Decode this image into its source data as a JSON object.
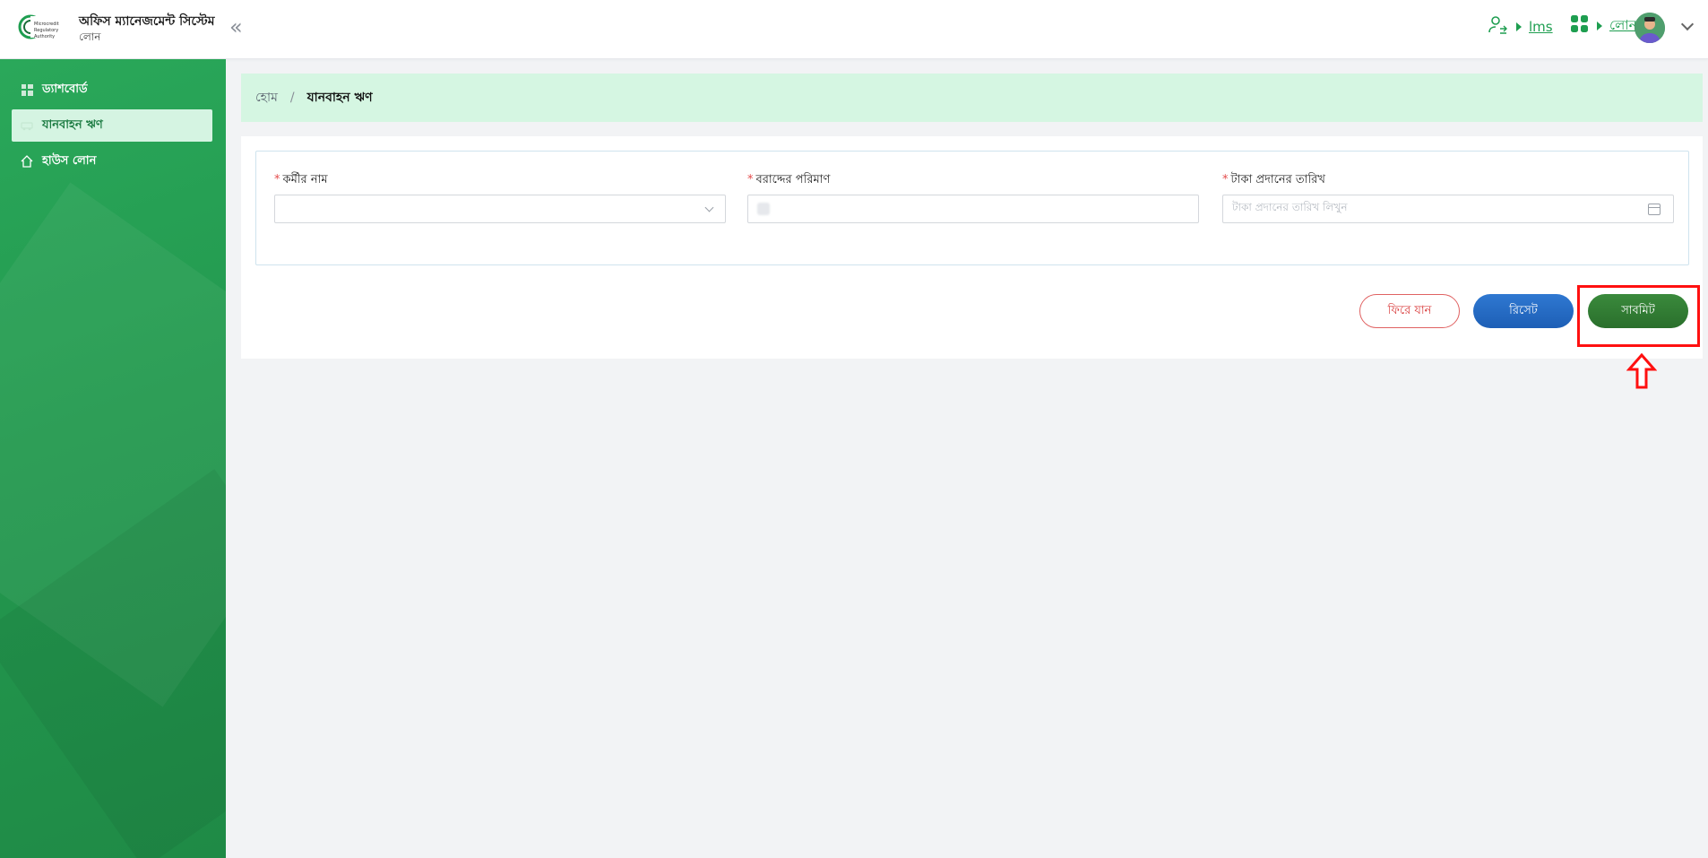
{
  "header": {
    "app_title": "অফিস ম্যানেজমেন্ট সিস্টেম",
    "app_subtitle": "লোন",
    "logo_text": [
      "Microcredit",
      "Regulatory",
      "Authority"
    ],
    "links": [
      {
        "label": "lms",
        "icon": "user-switch-icon"
      },
      {
        "label": "লোন",
        "icon": "apps-grid-icon"
      }
    ]
  },
  "sidebar": {
    "items": [
      {
        "label": "ড্যাশবোর্ড",
        "icon": "dashboard-icon",
        "active": false
      },
      {
        "label": "যানবাহন ঋণ",
        "icon": "vehicle-icon",
        "active": true
      },
      {
        "label": "হাউস লোন",
        "icon": "home-icon",
        "active": false
      }
    ]
  },
  "breadcrumb": {
    "home": "হোম",
    "separator": "/",
    "current": "যানবাহন ঋণ"
  },
  "form": {
    "fields": [
      {
        "label": "কর্মীর নাম",
        "required": "*",
        "value": "",
        "placeholder": ""
      },
      {
        "label": "বরাদ্দের পরিমাণ",
        "required": "*",
        "value": "",
        "placeholder": ""
      },
      {
        "label": "টাকা প্রদানের তারিখ",
        "required": "*",
        "value": "",
        "placeholder": "টাকা প্রদানের তারিখ লিখুন"
      }
    ],
    "buttons": {
      "back": "ফিরে যান",
      "reset": "রিসেট",
      "submit": "সাবমিট"
    }
  },
  "colors": {
    "primary_green": "#23994f",
    "active_bg": "#d5f4e2",
    "reset_blue": "#1d5fb6",
    "submit_green": "#2a6f2c",
    "highlight_red": "#ff1010"
  }
}
